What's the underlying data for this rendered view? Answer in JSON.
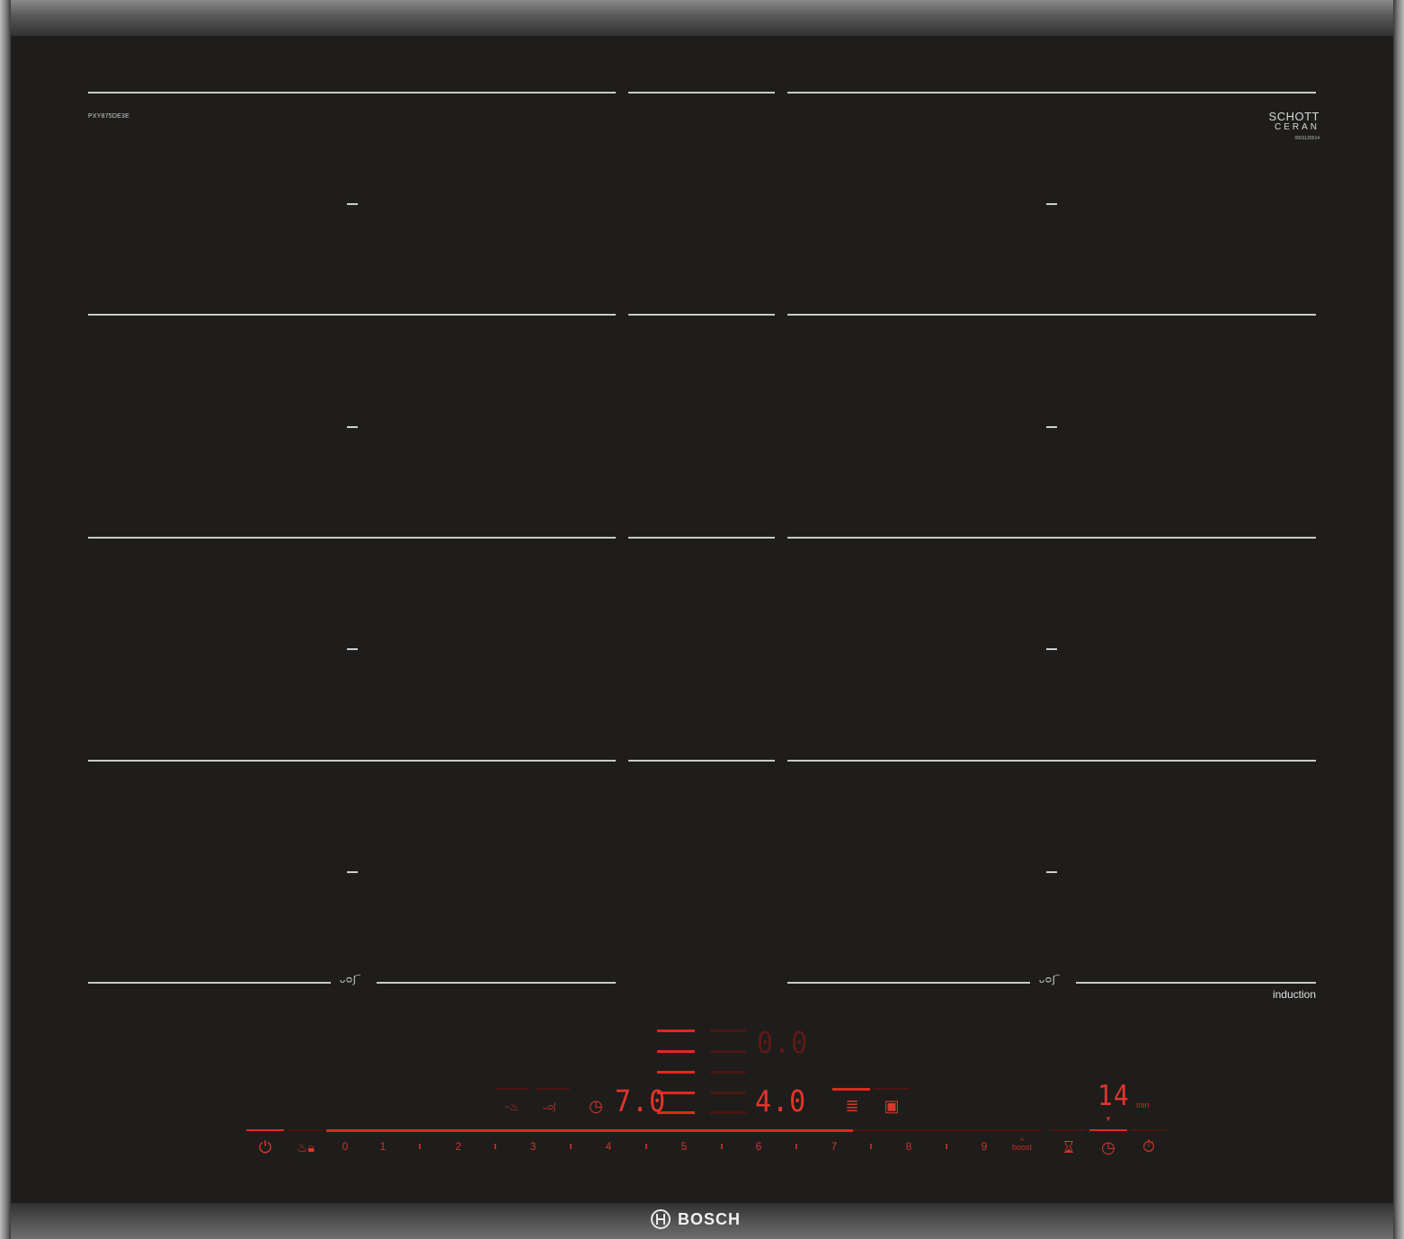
{
  "appliance": {
    "brand": "BOSCH",
    "model": "PXY875DE3E",
    "glass_brand": {
      "line1": "SCHOTT",
      "line2": "CERAN",
      "code": "0001120014"
    },
    "technology_label": "induction"
  },
  "display": {
    "zone_power_left": "7.0",
    "zone_power_right": "4.0",
    "top_readout": "0.0",
    "timer_value": "14",
    "timer_unit": "min"
  },
  "power_scale": {
    "numbers": [
      "0",
      "1",
      "2",
      "3",
      "4",
      "5",
      "6",
      "7",
      "8",
      "9"
    ],
    "boost_label": "boost"
  },
  "icons": {
    "power": "power-icon",
    "child_lock": "child-lock-icon",
    "flex_zone": "flex-zone-icon",
    "timer": "timer-icon",
    "kitchen_timer": "hourglass-icon",
    "stopwatch": "stopwatch-icon"
  },
  "colors": {
    "glass": "#1e1d1b",
    "indicator_red": "#e3342c",
    "frame": "#7a7a7a",
    "markings": "#c9c9c9"
  }
}
